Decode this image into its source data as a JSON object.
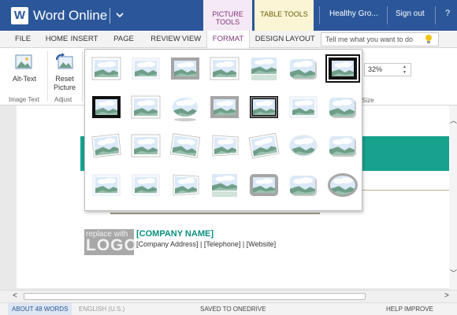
{
  "titlebar": {
    "app_icon_letter": "W",
    "app_title": "Word Online",
    "ctx_picture_tools": "PICTURE TOOLS",
    "ctx_table_tools": "TABLE TOOLS",
    "doc_name": "Healthy Gro...",
    "sign_out": "Sign out",
    "help": "?"
  },
  "tabs": {
    "file": "FILE",
    "home": "HOME",
    "insert": "INSERT",
    "page_layout": "PAGE LAYOUT",
    "review": "REVIEW",
    "view": "VIEW",
    "format": "FORMAT",
    "design": "DESIGN",
    "layout": "LAYOUT",
    "tell_me_placeholder": "Tell me what you want to do"
  },
  "ribbon": {
    "alt_text": "Alt-Text",
    "reset_picture": "Reset Picture",
    "group_image_text": "Image Text",
    "group_adjust": "Adjust",
    "scale_value": "32%",
    "group_size": "Size"
  },
  "gallery": {
    "rows": 4,
    "cols": 7,
    "selected_index": 6,
    "styles": [
      "simple-frame-white",
      "soft-edge",
      "thick-gray-frame",
      "plain",
      "reflected",
      "rounded-shadow",
      "black-frame",
      "thick-black-frame",
      "shadow-rectangle",
      "oval",
      "metal-frame",
      "black-double-frame",
      "beveled-soft",
      "rounded-glow",
      "rotated-white-left",
      "drop-shadow",
      "rotated-white-right",
      "perspective-white",
      "perspective-tilt",
      "oval-glow",
      "rounded-diagonal",
      "soft-top",
      "beveled-top",
      "bevel-perspective",
      "reflected-bevel",
      "metal-rounded",
      "rounded-bevel-glow",
      "metal-oval"
    ],
    "colors": {
      "sky": "#dbe9f8",
      "cloud": "#ffffff",
      "hill": "#6f9e88",
      "hill_light": "#9ac0ae",
      "frame_black": "#111111",
      "frame_gray": "#a6a6a6"
    }
  },
  "document": {
    "logo_small": "replace with",
    "logo_big": "LOGO",
    "company_name": "[COMPANY NAME]",
    "contact_line": "[Company Address] | [Telephone] | [Website]",
    "teal_color": "#17a28e"
  },
  "statusbar": {
    "words": "ABOUT 48 WORDS",
    "language": "ENGLISH (U.S.)",
    "saved": "SAVED TO ONEDRIVE",
    "improve": "HELP IMPROVE OFFICE"
  }
}
